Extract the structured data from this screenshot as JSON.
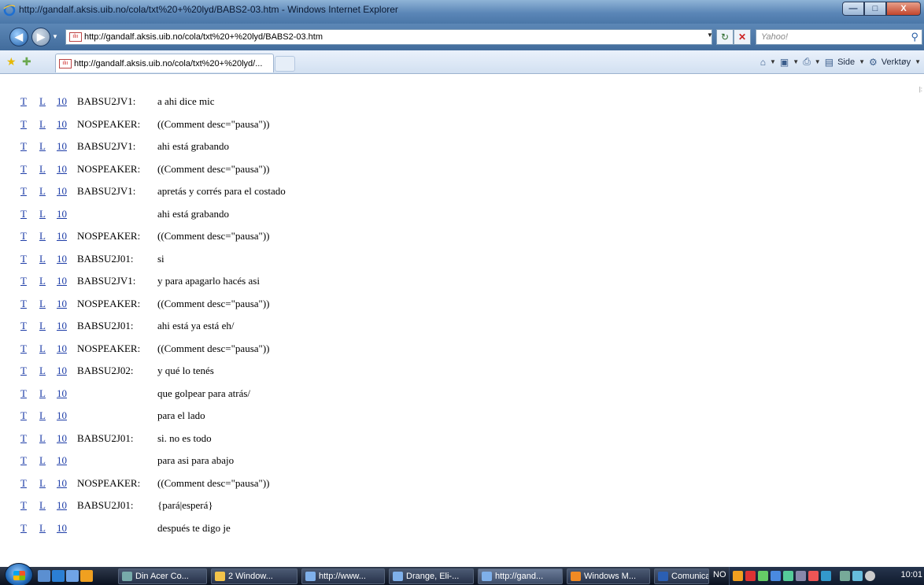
{
  "window": {
    "title": "http://gandalf.aksis.uib.no/cola/txt%20+%20lyd/BABS2-03.htm - Windows Internet Explorer",
    "minimize_glyph": "—",
    "maximize_glyph": "□",
    "close_glyph": "X"
  },
  "address_bar": {
    "url": "http://gandalf.aksis.uib.no/cola/txt%20+%20lyd/BABS2-03.htm",
    "search_placeholder": "Yahoo!"
  },
  "tab": {
    "label": "http://gandalf.aksis.uib.no/cola/txt%20+%20lyd/..."
  },
  "command_bar": {
    "page_label": "Side",
    "tools_label": "Verktøy"
  },
  "transcript": {
    "link_t": "T",
    "link_l": "L",
    "link_num": "10",
    "rows": [
      {
        "speaker": "BABSU2JV1:",
        "text": "a ahi dice mic"
      },
      {
        "speaker": "NOSPEAKER:",
        "text": "((Comment desc=\"pausa\"))"
      },
      {
        "speaker": "BABSU2JV1:",
        "text": "ahi está grabando"
      },
      {
        "speaker": "NOSPEAKER:",
        "text": "((Comment desc=\"pausa\"))"
      },
      {
        "speaker": "BABSU2JV1:",
        "text": "apretás y corrés para el costado"
      },
      {
        "speaker": "",
        "text": "ahi está grabando"
      },
      {
        "speaker": "NOSPEAKER:",
        "text": "((Comment desc=\"pausa\"))"
      },
      {
        "speaker": "BABSU2J01:",
        "text": "si"
      },
      {
        "speaker": "BABSU2JV1:",
        "text": "y para apagarlo hacés asi"
      },
      {
        "speaker": "NOSPEAKER:",
        "text": "((Comment desc=\"pausa\"))"
      },
      {
        "speaker": "BABSU2J01:",
        "text": "ahi está ya está eh/"
      },
      {
        "speaker": "NOSPEAKER:",
        "text": "((Comment desc=\"pausa\"))"
      },
      {
        "speaker": "BABSU2J02:",
        "text": "y qué lo tenés"
      },
      {
        "speaker": "",
        "text": "que golpear para atrás/"
      },
      {
        "speaker": "",
        "text": "para el lado"
      },
      {
        "speaker": "BABSU2J01:",
        "text": "si. no es todo"
      },
      {
        "speaker": "",
        "text": "para asi para abajo"
      },
      {
        "speaker": "NOSPEAKER:",
        "text": "((Comment desc=\"pausa\"))"
      },
      {
        "speaker": "BABSU2J01:",
        "text": "{pará|esperá}"
      },
      {
        "speaker": "",
        "text": "después te digo je"
      }
    ]
  },
  "taskbar": {
    "tasks": [
      {
        "label": "Din Acer Co...",
        "icon": "acer-icon"
      },
      {
        "label": "2 Window...",
        "icon": "folder-icon"
      },
      {
        "label": "http://www...",
        "icon": "ie-icon"
      },
      {
        "label": "Drange, Eli-...",
        "icon": "ie-icon"
      },
      {
        "label": "http://gand...",
        "icon": "ie-icon"
      },
      {
        "label": "Windows M...",
        "icon": "media-player-icon"
      },
      {
        "label": "Comunicaci...",
        "icon": "word-icon"
      }
    ],
    "language": "NO",
    "clock": "10:01"
  }
}
